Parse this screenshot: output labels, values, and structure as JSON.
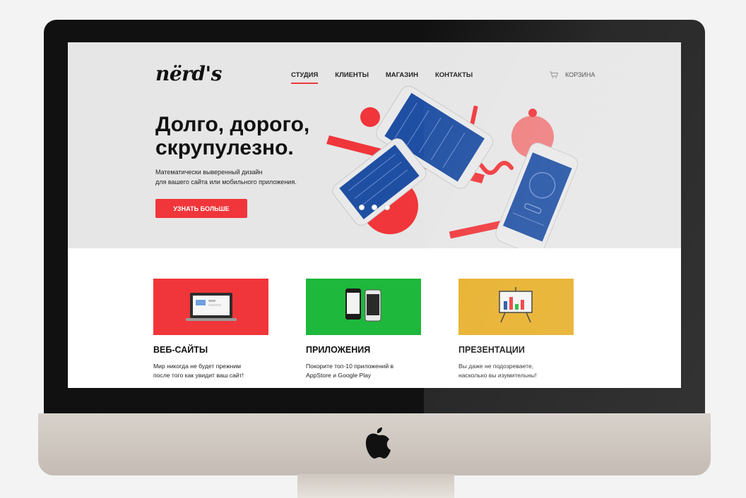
{
  "brand": {
    "logo": "nërd's"
  },
  "nav": {
    "items": [
      {
        "label": "СТУДИЯ",
        "active": true
      },
      {
        "label": "КЛИЕНТЫ",
        "active": false
      },
      {
        "label": "МАГАЗИН",
        "active": false
      },
      {
        "label": "КОНТАКТЫ",
        "active": false
      }
    ],
    "cart_label": "КОРЗИНА"
  },
  "hero": {
    "headline_line1": "Долго, дорого,",
    "headline_line2": "скрупулезно.",
    "sub_line1": "Математически выверенный дизайн",
    "sub_line2": "для вашего сайта или мобильного приложения.",
    "cta_label": "УЗНАТЬ БОЛЬШЕ",
    "slides": 3,
    "active_slide": 1
  },
  "services": [
    {
      "title": "ВЕБ-САЙТЫ",
      "desc_line1": "Мир никогда не будет прежним",
      "desc_line2": "после того как увидит ваш сайт!",
      "color": "#f0363a",
      "icon": "laptop-icon"
    },
    {
      "title": "ПРИЛОЖЕНИЯ",
      "desc_line1": "Покорите топ-10 приложений в",
      "desc_line2": "AppStore и Google Play",
      "color": "#1eb83c",
      "icon": "phones-icon"
    },
    {
      "title": "ПРЕЗЕНТАЦИИ",
      "desc_line1": "Вы даже не подозреваете,",
      "desc_line2": "насколько вы изумительны!",
      "color": "#e7ae25",
      "icon": "presentation-board-icon"
    }
  ],
  "colors": {
    "accent": "#f0363a",
    "hero_bg": "#e6e6e6",
    "app_blue": "#1f4fa3"
  }
}
